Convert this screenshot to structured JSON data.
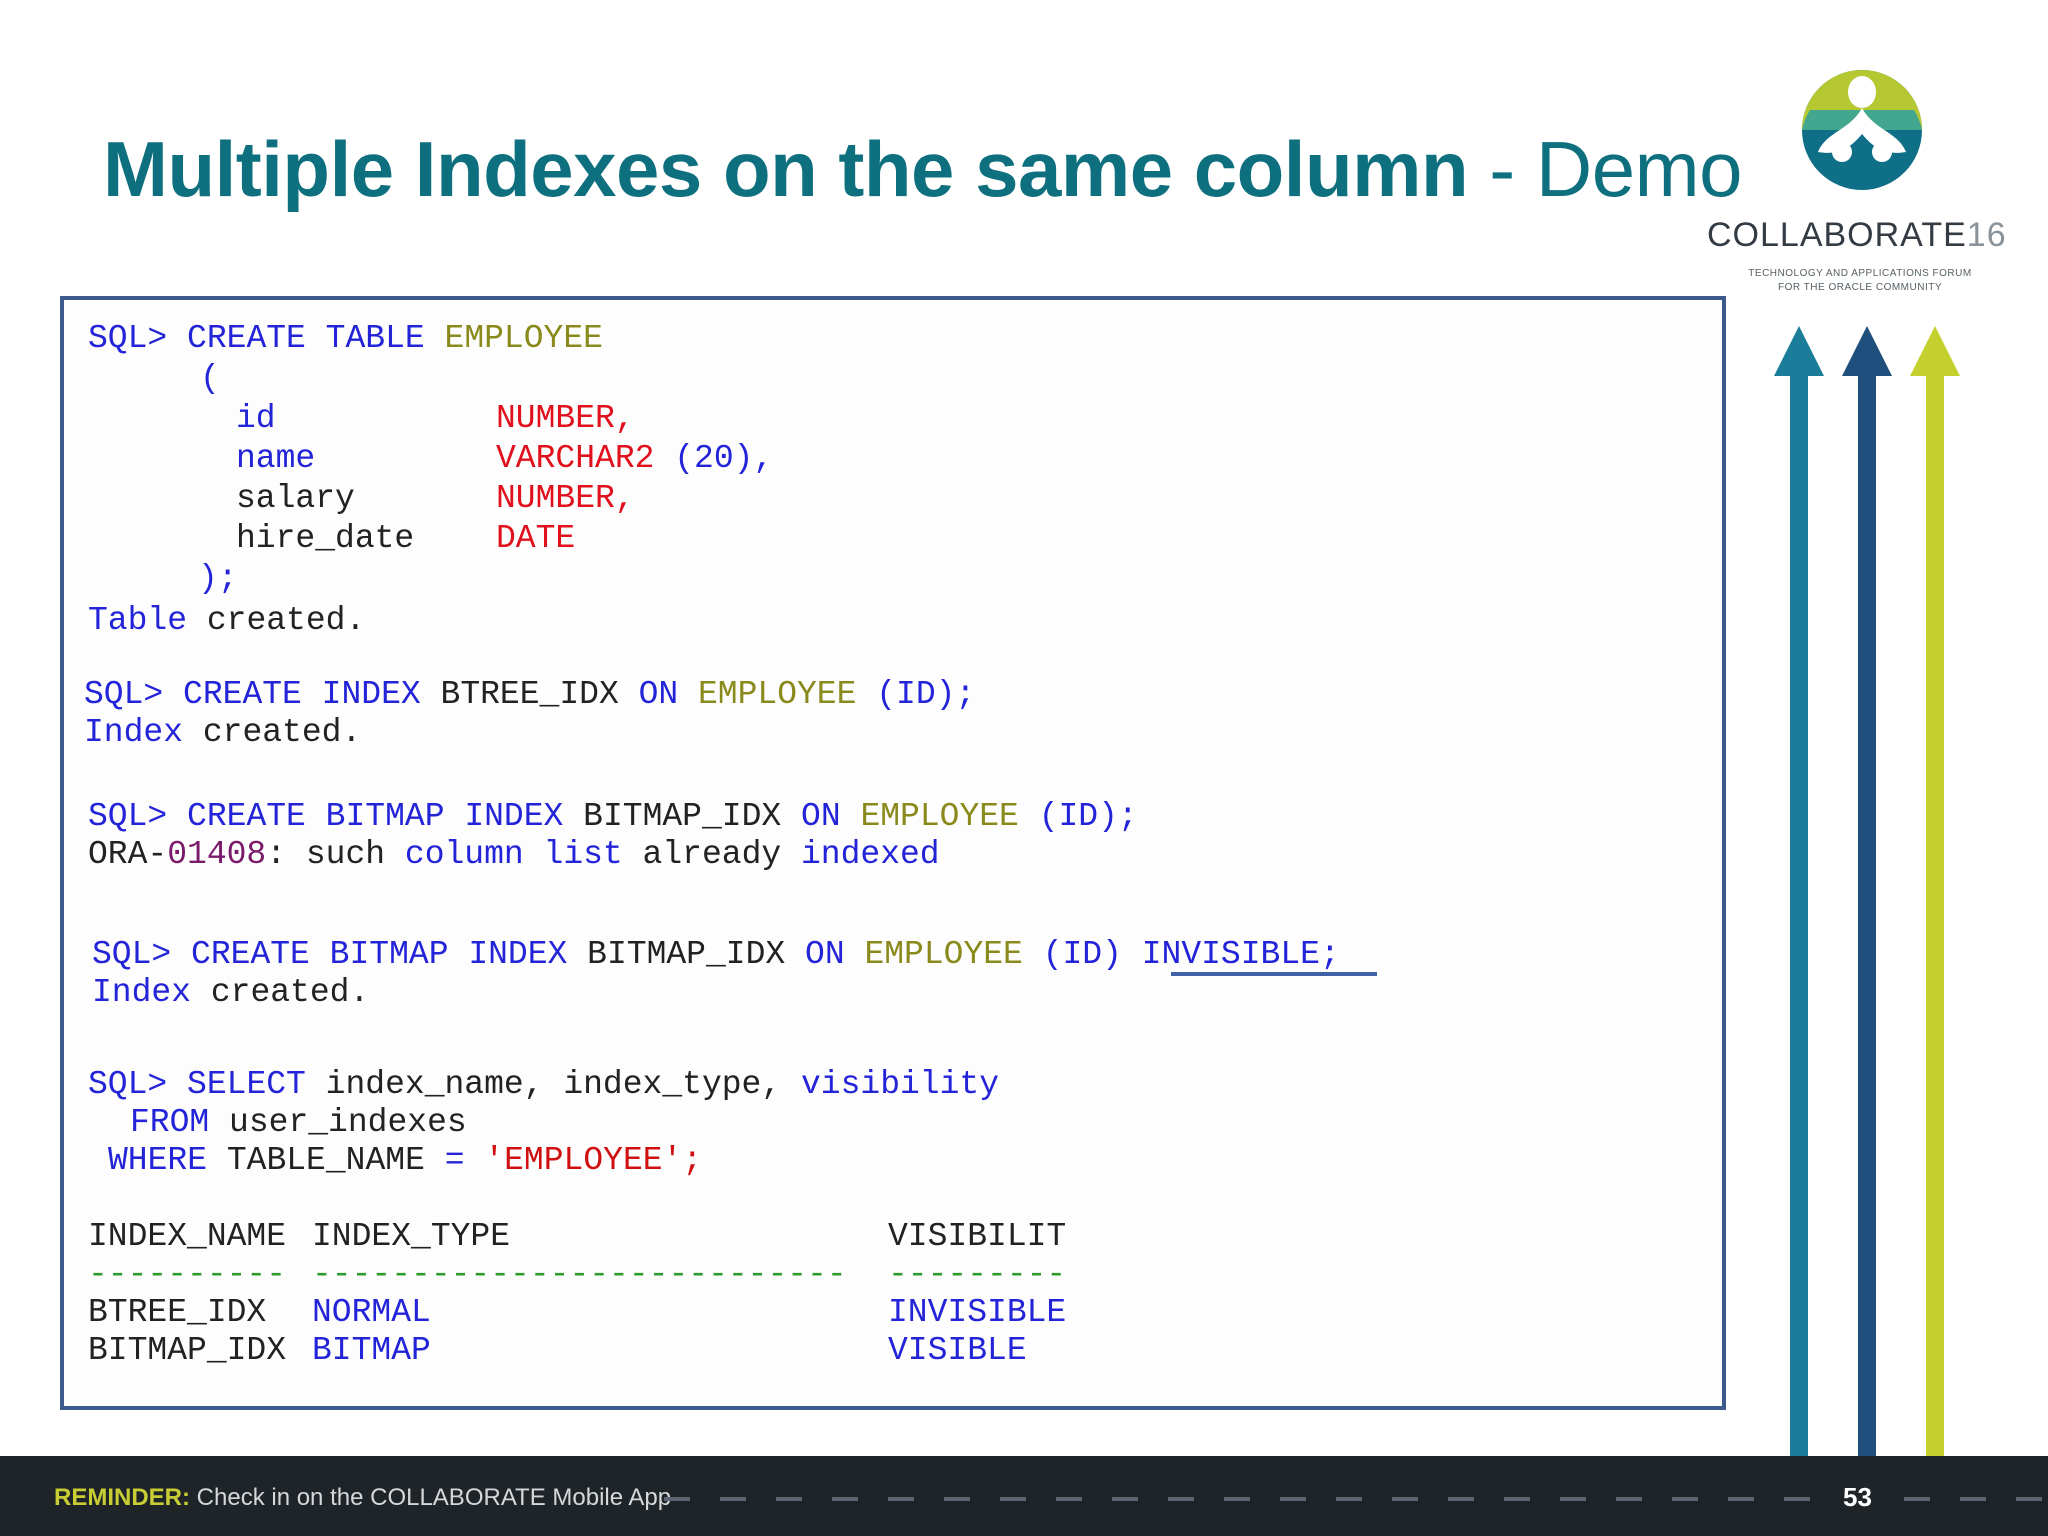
{
  "slide": {
    "title_bold": "Multiple Indexes on the same column",
    "title_light": " - Demo",
    "page_number": "53"
  },
  "logo": {
    "brand": "COLLABORATE",
    "brand_num": "16",
    "tagline_1": "TECHNOLOGY AND APPLICATIONS FORUM",
    "tagline_2": "FOR THE ORACLE COMMUNITY"
  },
  "footer": {
    "reminder_label": "REMINDER:",
    "reminder_text": " Check in on the COLLABORATE Mobile App"
  },
  "code": {
    "create_table": {
      "prompt": "SQL>",
      "create": "CREATE",
      "table": "TABLE",
      "table_name": "EMPLOYEE",
      "open_paren": "(",
      "columns": [
        {
          "name": "id",
          "type": "NUMBER,"
        },
        {
          "name": "name",
          "type": "VARCHAR2",
          "size": "(20),"
        },
        {
          "name": "salary",
          "type": "NUMBER,"
        },
        {
          "name": "hire_date",
          "type": "DATE"
        }
      ],
      "close_paren": ");",
      "result_1": "Table",
      "result_2": "created."
    },
    "btree_index": {
      "statement": [
        "SQL>",
        "CREATE",
        "INDEX",
        "BTREE_IDX",
        "ON",
        "EMPLOYEE",
        "(ID);"
      ],
      "result": [
        "Index",
        "created."
      ]
    },
    "bitmap_fail": {
      "statement": [
        "SQL>",
        "CREATE",
        "BITMAP",
        "INDEX",
        "BITMAP_IDX",
        "ON",
        "EMPLOYEE",
        "(ID);"
      ],
      "error": [
        "ORA-",
        "01408",
        ": such",
        "column list",
        "already",
        "indexed"
      ]
    },
    "bitmap_invisible": {
      "statement": [
        "SQL>",
        "CREATE",
        "BITMAP",
        "INDEX",
        "BITMAP_IDX",
        "ON",
        "EMPLOYEE",
        "(ID)",
        "INVISIBLE;"
      ],
      "result": [
        "Index",
        "created."
      ]
    },
    "select": {
      "line1": [
        "SQL>",
        "SELECT",
        "index_name,",
        "index_type,",
        "visibility"
      ],
      "line2": [
        "FROM",
        "user_indexes"
      ],
      "line3": [
        "WHERE",
        "TABLE_NAME",
        "=",
        "'EMPLOYEE';"
      ]
    },
    "result_table": {
      "headers": [
        "INDEX_NAME",
        "INDEX_TYPE",
        "VISIBILIT"
      ],
      "separators": [
        "----------",
        "---------------------------",
        "---------"
      ],
      "rows": [
        {
          "index_name": "BTREE_IDX",
          "index_type": "NORMAL",
          "visibility": "INVISIBLE"
        },
        {
          "index_name": "BITMAP_IDX",
          "index_type": "BITMAP",
          "visibility": "VISIBLE"
        }
      ]
    }
  },
  "colors": {
    "title": "#0e6f7e",
    "code_border": "#3d5a8c",
    "keyword": "#2323d8",
    "table_name": "#8a8a1c",
    "datatype": "#e0101c",
    "arrow_teal": "#1b7d99",
    "arrow_navy": "#1f4f7d",
    "arrow_lime": "#c3d02e",
    "footer_bg": "#1f2428"
  }
}
